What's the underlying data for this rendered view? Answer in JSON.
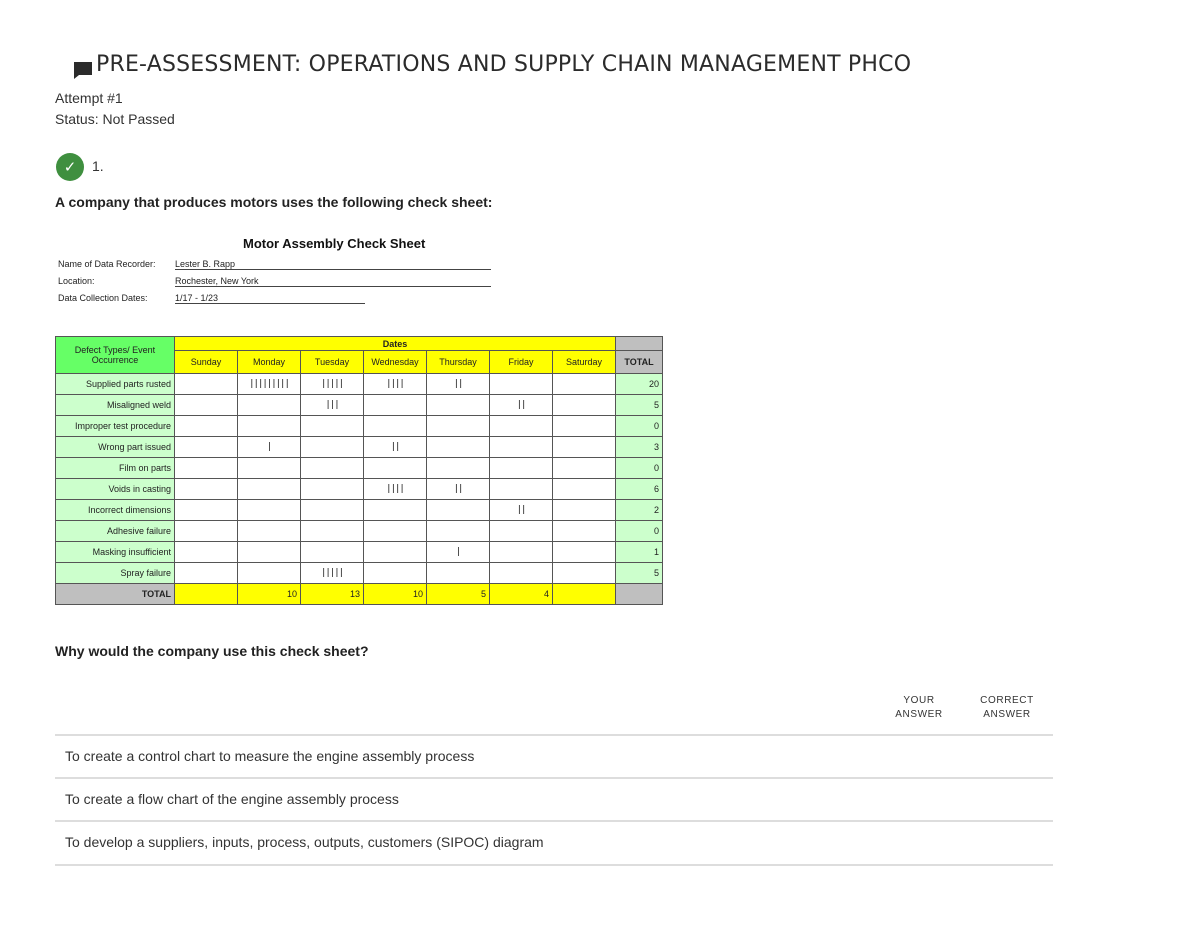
{
  "page": {
    "title": "PRE-ASSESSMENT: OPERATIONS AND SUPPLY CHAIN MANAGEMENT PHCO",
    "attempt": "Attempt #1",
    "status": "Status: Not Passed"
  },
  "question": {
    "number": "1.",
    "intro": "A company that produces motors uses the following check sheet:",
    "prompt": "Why would the company use this check sheet?",
    "your_answer_label": "YOUR ANSWER",
    "correct_answer_label": "CORRECT ANSWER",
    "options": [
      "To create a control chart to measure the engine assembly process",
      "To create a flow chart of the engine assembly process",
      "To develop a suppliers, inputs, process, outputs, customers (SIPOC) diagram"
    ]
  },
  "check_sheet": {
    "title": "Motor Assembly Check Sheet",
    "recorder_label": "Name of Data Recorder:",
    "recorder_value": "Lester B. Rapp",
    "location_label": "Location:",
    "location_value": "Rochester, New York",
    "dates_label": "Data Collection Dates:",
    "dates_value": "1/17 - 1/23",
    "dates_header": "Dates",
    "defect_header": "Defect Types/ Event Occurrence",
    "days": [
      "Sunday",
      "Monday",
      "Tuesday",
      "Wednesday",
      "Thursday",
      "Friday",
      "Saturday"
    ],
    "total_label": "TOTAL",
    "rows": [
      {
        "label": "Supplied parts rusted",
        "tallies": [
          "",
          "|||||||||",
          "|||||",
          "||||",
          "||",
          "",
          ""
        ],
        "total": "20"
      },
      {
        "label": "Misaligned weld",
        "tallies": [
          "",
          "",
          "|||",
          "",
          "",
          "||",
          ""
        ],
        "total": "5"
      },
      {
        "label": "Improper test procedure",
        "tallies": [
          "",
          "",
          "",
          "",
          "",
          "",
          ""
        ],
        "total": "0"
      },
      {
        "label": "Wrong part issued",
        "tallies": [
          "",
          "|",
          "",
          "||",
          "",
          "",
          ""
        ],
        "total": "3"
      },
      {
        "label": "Film on parts",
        "tallies": [
          "",
          "",
          "",
          "",
          "",
          "",
          ""
        ],
        "total": "0"
      },
      {
        "label": "Voids in casting",
        "tallies": [
          "",
          "",
          "",
          "||||",
          "||",
          "",
          ""
        ],
        "total": "6"
      },
      {
        "label": "Incorrect dimensions",
        "tallies": [
          "",
          "",
          "",
          "",
          "",
          "||",
          ""
        ],
        "total": "2"
      },
      {
        "label": "Adhesive failure",
        "tallies": [
          "",
          "",
          "",
          "",
          "",
          "",
          ""
        ],
        "total": "0"
      },
      {
        "label": "Masking insufficient",
        "tallies": [
          "",
          "",
          "",
          "",
          "|",
          "",
          ""
        ],
        "total": "1"
      },
      {
        "label": "Spray failure",
        "tallies": [
          "",
          "",
          "|||||",
          "",
          "",
          "",
          ""
        ],
        "total": "5"
      }
    ],
    "day_totals": [
      "",
      "10",
      "13",
      "10",
      "5",
      "4",
      ""
    ]
  },
  "icons": {
    "check": "check-circle-icon",
    "flag": "flag-icon"
  },
  "colors": {
    "check_green": "#3f8f3f",
    "header_yellow": "#ffff00",
    "defect_green": "#66ff66"
  }
}
